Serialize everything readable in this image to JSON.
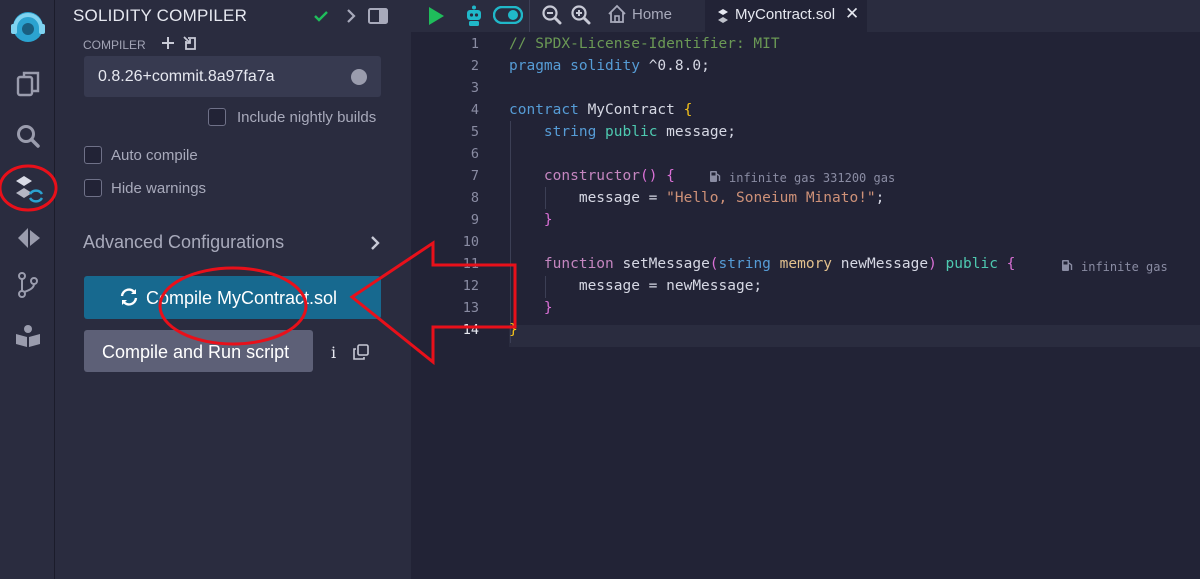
{
  "panel": {
    "title": "SOLIDITY COMPILER",
    "compiler_label": "COMPILER",
    "compiler_version": "0.8.26+commit.8a97fa7a",
    "nightly_label": "Include nightly builds",
    "auto_compile_label": "Auto compile",
    "hide_warnings_label": "Hide warnings",
    "advanced_label": "Advanced Configurations",
    "compile_button": "Compile MyContract.sol",
    "run_script_button": "Compile and Run script",
    "info_glyph": "i"
  },
  "tabs": {
    "home": "Home",
    "active_file": "MyContract.sol",
    "close_glyph": "✕"
  },
  "editor": {
    "line_numbers": [
      "1",
      "2",
      "3",
      "4",
      "5",
      "6",
      "7",
      "8",
      "9",
      "10",
      "11",
      "12",
      "13",
      "14"
    ],
    "lines": [
      "// SPDX-License-Identifier: MIT",
      "pragma solidity ^0.8.0;",
      "",
      "contract MyContract {",
      "    string public message;",
      "",
      "    constructor() {",
      "        message = \"Hello, Soneium Minato!\";",
      "    }",
      "",
      "    function setMessage(string memory newMessage) public {",
      "        message = newMessage;",
      "    }",
      "}"
    ],
    "gas_constructor": "infinite gas 331200 gas",
    "gas_setmessage": "infinite gas"
  },
  "colors": {
    "accent_green": "#1fbd5b",
    "accent_teal": "#20b8c9",
    "annotation_red": "#e8101a",
    "compile_button_bg": "#17698f"
  },
  "icons": [
    "remix-logo-icon",
    "file-explorer-icon",
    "search-icon",
    "solidity-compiler-icon",
    "deploy-run-icon",
    "git-icon",
    "learneth-icon",
    "checkmark-icon",
    "chevron-right-icon",
    "panel-toggle-icon",
    "add-icon",
    "import-icon",
    "run-play-icon",
    "copilot-robot-icon",
    "toggle-switch-icon",
    "zoom-out-icon",
    "zoom-in-icon",
    "home-icon",
    "solidity-file-icon",
    "close-icon",
    "gas-pump-icon",
    "refresh-icon",
    "copy-icon"
  ]
}
